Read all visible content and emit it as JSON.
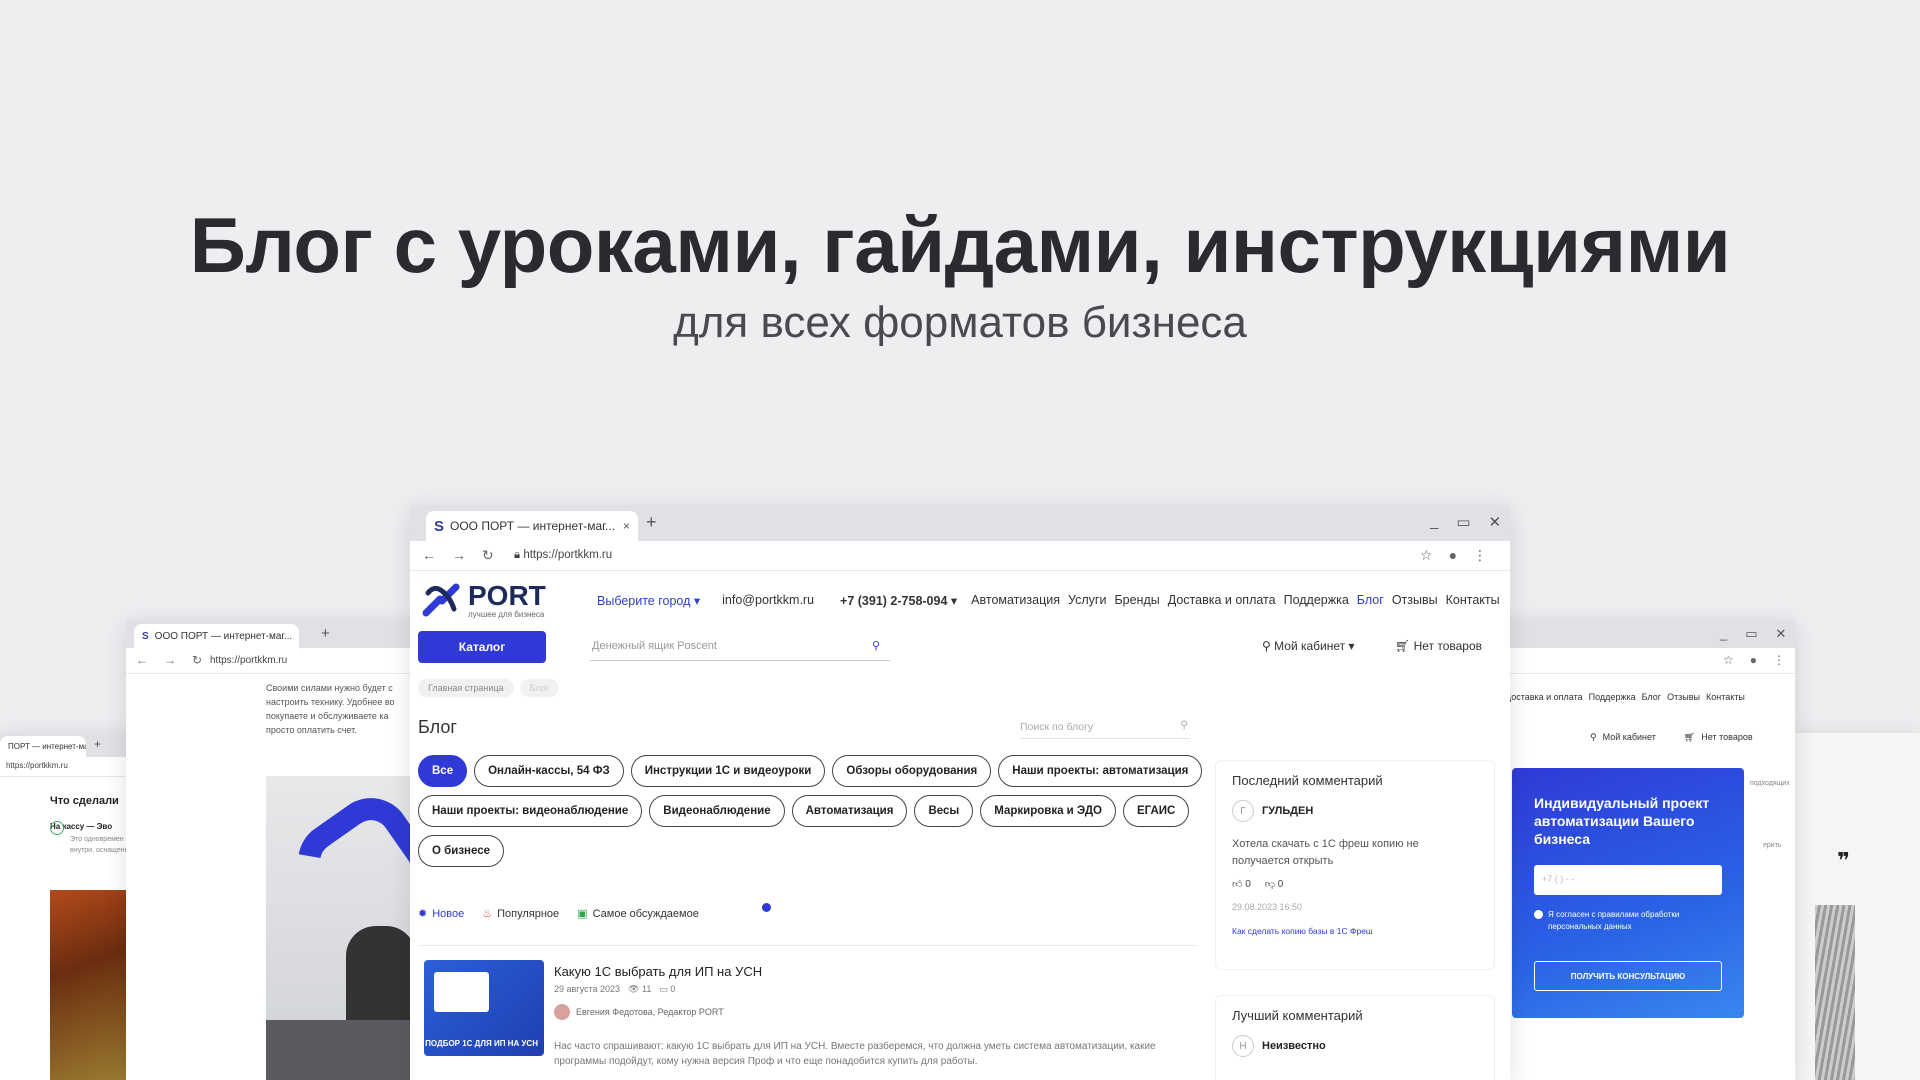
{
  "hero": {
    "title": "Блог с уроками, гайдами, инструкциями",
    "subtitle": "для всех форматов бизнеса"
  },
  "browser": {
    "tab_title": "ООО ПОРТ — интернет-маг...",
    "tab_title_short": "ПОРТ — интернет-маг...",
    "tab_close": "×",
    "new_tab": "+",
    "url": "https://portkkm.ru",
    "url_back": "https://portkkm.ru",
    "win_controls": [
      "_",
      "▭",
      "✕"
    ]
  },
  "site": {
    "logo_text": "PORT",
    "logo_sub": "лучшее для бизнеса",
    "city": "Выберите город",
    "email": "info@portkkm.ru",
    "phone": "+7 (391) 2-758-094",
    "nav": [
      "Автоматизация",
      "Услуги",
      "Бренды",
      "Доставка и оплата",
      "Поддержка",
      "Блог",
      "Отзывы",
      "Контакты"
    ],
    "catalog": "Каталог",
    "search_placeholder": "Денежный ящик Poscent",
    "cabinet": "Мой кабинет",
    "cart": "Нет товаров",
    "breadcrumbs": [
      "Главная страница",
      "Блог"
    ]
  },
  "blog": {
    "title": "Блог",
    "search_placeholder": "Поиск по блогу",
    "chips": [
      "Все",
      "Онлайн-кассы, 54 ФЗ",
      "Инструкции 1С и видеоуроки",
      "Обзоры оборудования",
      "Наши проекты: автоматизация",
      "Наши проекты: видеонаблюдение",
      "Видеонаблюдение",
      "Автоматизация",
      "Весы",
      "Маркировка и ЭДО",
      "ЕГАИС",
      "О бизнесе"
    ],
    "sort": [
      "Новое",
      "Популярное",
      "Самое обсуждаемое"
    ],
    "post": {
      "title": "Какую 1С выбрать для ИП на УСН",
      "date": "29 августа 2023",
      "views": "11",
      "comments": "0",
      "author": "Евгения Федотова, Редактор PORT",
      "thumb_caption": "ПОДБОР 1С ДЛЯ ИП НА УСН",
      "excerpt": "Нас часто спрашивают: какую 1С выбрать для ИП на УСН. Вместе разберемся, что должна уметь система автоматизации, какие программы подойдут, кому нужна версия Проф и что еще понадобится купить для работы."
    }
  },
  "sidebar": {
    "last_comment_title": "Последний комментарий",
    "last_comment_user": "ГУЛЬДЕН",
    "last_comment_initial": "Г",
    "last_comment_text": "Хотела скачать с 1С фреш копию не получается  открыть",
    "likes": "0",
    "dislikes": "0",
    "date": "29.08.2023 16:50",
    "link": "Как сделать копию базы в 1С Фреш",
    "best_comment_title": "Лучший комментарий",
    "best_comment_user": "Неизвестно",
    "best_comment_initial": "Н"
  },
  "promo": {
    "title": "Индивидуальный проект автоматизации Вашего бизнеса",
    "phone_placeholder": "+7 (  )  -  -",
    "agree": "Я согласен с правилами обработки персональных данных",
    "cta": "ПОЛУЧИТЬ КОНСУЛЬТАЦИЮ"
  },
  "back_left": {
    "text": "Своими силами нужно будет с настроить технику. Удобнее во покупаете и обслуживаете ка просто оплатить счет.",
    "heading": "Что сделали",
    "item": "На кассу — Эво",
    "item_sub": "Это одновремен внутри, оснащенн"
  },
  "back_right": {
    "nav": [
      "Доставка и оплата",
      "Поддержка",
      "Блог",
      "Отзывы",
      "Контакты"
    ],
    "cabinet": "Мой кабинет",
    "cart": "Нет товаров",
    "side_word": "подходящих",
    "side_word2": "ерить",
    "quote": "❞"
  },
  "colors": {
    "accent": "#2f3ad6",
    "background": "#eeedf0"
  }
}
